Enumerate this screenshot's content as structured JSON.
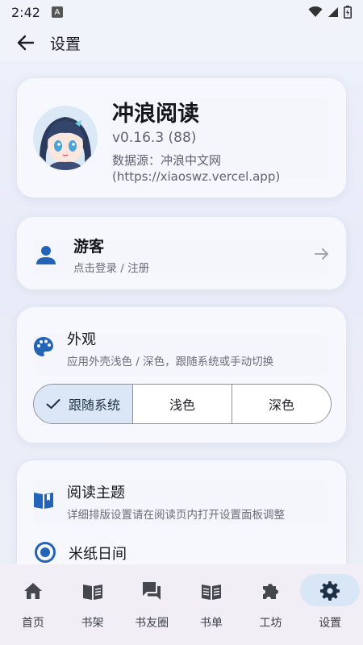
{
  "status_bar": {
    "time": "2:42",
    "a_badge": "A"
  },
  "app_bar": {
    "title": "设置",
    "back_icon": "arrow-left-icon"
  },
  "app_info": {
    "name": "冲浪阅读",
    "version": "v0.16.3 (88)",
    "source": "数据源：冲浪中文网 (https://xiaoswz.vercel.app)"
  },
  "user": {
    "name": "游客",
    "subtitle": "点击登录 / 注册",
    "icon": "person-icon",
    "arrow_icon": "arrow-right-icon"
  },
  "appearance": {
    "title": "外观",
    "subtitle": "应用外壳浅色 / 深色，跟随系统或手动切换",
    "icon": "palette-icon",
    "options": [
      {
        "label": "跟随系统",
        "selected": true
      },
      {
        "label": "浅色",
        "selected": false
      },
      {
        "label": "深色",
        "selected": false
      }
    ]
  },
  "reading_theme": {
    "title": "阅读主题",
    "subtitle": "详细排版设置请在阅读页内打开设置面板调整",
    "icon": "open-book-icon",
    "selected_option": "米纸日间"
  },
  "bottom_nav": [
    {
      "label": "首页",
      "icon": "home-icon",
      "active": false
    },
    {
      "label": "书架",
      "icon": "book-icon",
      "active": false
    },
    {
      "label": "书友圈",
      "icon": "forum-icon",
      "active": false
    },
    {
      "label": "书单",
      "icon": "book-list-icon",
      "active": false
    },
    {
      "label": "工坊",
      "icon": "puzzle-icon",
      "active": false
    },
    {
      "label": "设置",
      "icon": "gear-icon",
      "active": true
    }
  ],
  "colors": {
    "accent": "#2364b8",
    "nav_active_pill": "#d8e6f6",
    "segment_selected": "#dbe6f7"
  }
}
